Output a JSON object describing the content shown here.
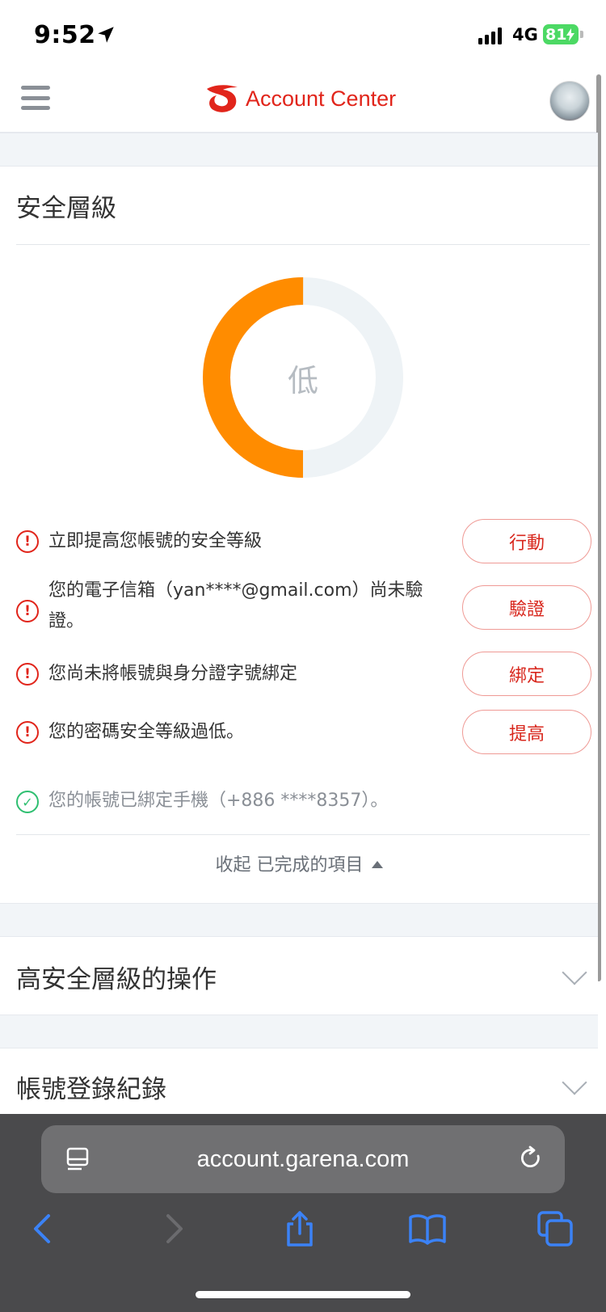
{
  "status_bar": {
    "time": "9:52",
    "network": "4G",
    "battery": "81"
  },
  "header": {
    "brand": "Account Center",
    "menu_icon": "hamburger-menu-icon",
    "avatar_icon": "user-avatar"
  },
  "security": {
    "title": "安全層級",
    "level_label": "低",
    "level_fraction": 0.5,
    "colors": {
      "progress": "#ff8c00",
      "track": "#eef3f6",
      "warning": "#e1251b",
      "ok": "#2fbf71"
    },
    "items": [
      {
        "text": "立即提高您帳號的安全等級",
        "button": "行動"
      },
      {
        "text": "您的電子信箱（yan****@gmail.com）尚未驗",
        "text2": "證。",
        "button": "驗證"
      },
      {
        "text": "您尚未將帳號與身分證字號綁定",
        "button": "綁定"
      },
      {
        "text": "您的密碼安全等級過低。",
        "button": "提高"
      }
    ],
    "completed": "您的帳號已綁定手機（+886 ****8357）。",
    "collapse_label": "收起 已完成的項目"
  },
  "sections": {
    "high_security_ops": "高安全層級的操作",
    "login_history": "帳號登錄紀錄"
  },
  "browser": {
    "url": "account.garena.com"
  }
}
